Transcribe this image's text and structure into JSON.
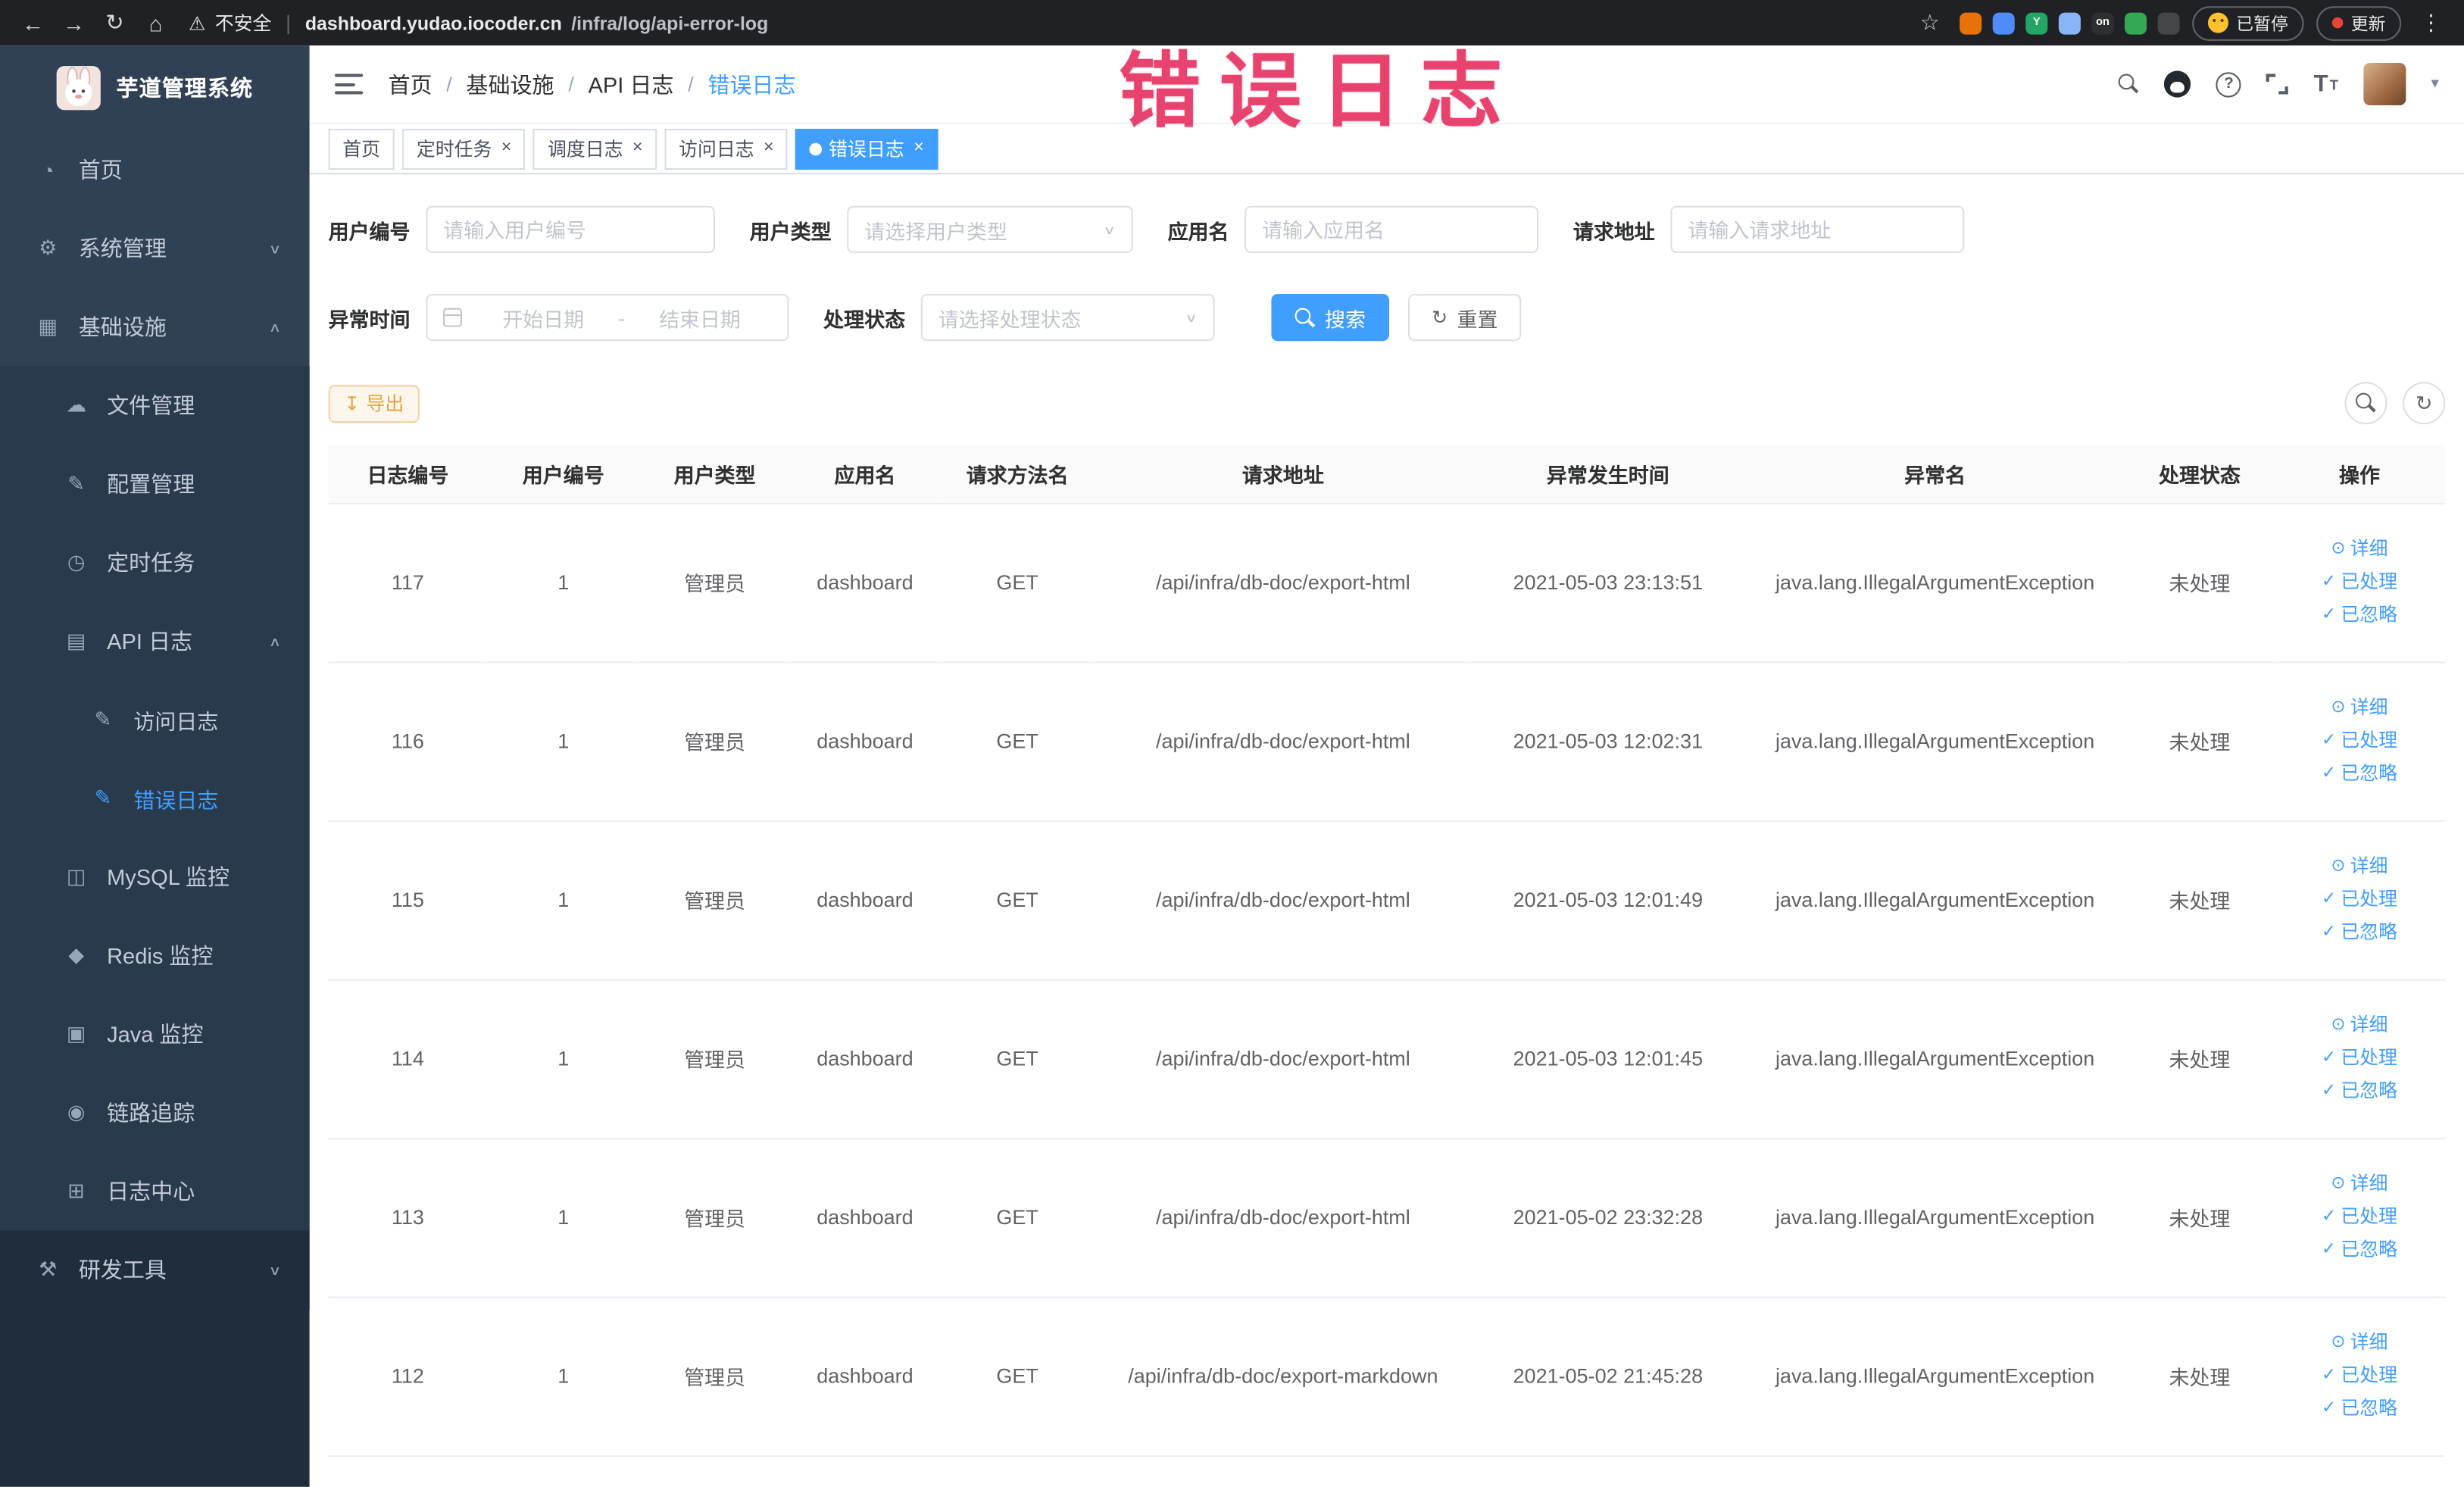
{
  "colors": {
    "accent": "#409eff",
    "sidebar_bg": "#304156",
    "sidebar_dark": "#1f2d3d",
    "warning_orange": "#e6a23c",
    "annotation_pink": "#e8436e"
  },
  "browser": {
    "security": "不安全",
    "url_host": "dashboard.yudao.iocoder.cn",
    "url_path": "/infra/log/api-error-log",
    "paused_pill": "已暂停",
    "update_pill": "更新",
    "extensions": [
      {
        "color": "#e8710a"
      },
      {
        "color": "#4e8cf9"
      },
      {
        "color": "#23a566",
        "text": "Y"
      },
      {
        "color": "#8ab4f8"
      },
      {
        "color": "#2d2f31",
        "text": "on"
      },
      {
        "color": "#34a853"
      },
      {
        "color": "#44474a"
      }
    ]
  },
  "annotation": {
    "text": "错误日志"
  },
  "sidebar": {
    "title": "芋道管理系统",
    "menu": [
      {
        "label": "首页",
        "icon": "dashboard-icon",
        "level": 1
      },
      {
        "label": "系统管理",
        "icon": "gear-icon",
        "level": 1,
        "arrow": "down"
      },
      {
        "label": "基础设施",
        "icon": "infrastructure-icon",
        "level": 1,
        "arrow": "up"
      },
      {
        "label": "文件管理",
        "icon": "file-icon",
        "level": 2
      },
      {
        "label": "配置管理",
        "icon": "config-icon",
        "level": 2
      },
      {
        "label": "定时任务",
        "icon": "job-icon",
        "level": 2
      },
      {
        "label": "API 日志",
        "icon": "api-log-icon",
        "level": 2,
        "arrow": "up"
      },
      {
        "label": "访问日志",
        "icon": "access-log-icon",
        "level": 3
      },
      {
        "label": "错误日志",
        "icon": "error-log-icon",
        "level": 3,
        "active": true
      },
      {
        "label": "MySQL 监控",
        "icon": "mysql-icon",
        "level": 2
      },
      {
        "label": "Redis 监控",
        "icon": "redis-icon",
        "level": 2
      },
      {
        "label": "Java 监控",
        "icon": "java-icon",
        "level": 2
      },
      {
        "label": "链路追踪",
        "icon": "trace-icon",
        "level": 2
      },
      {
        "label": "日志中心",
        "icon": "log-center-icon",
        "level": 2
      },
      {
        "label": "研发工具",
        "icon": "devtools-icon",
        "level": 1,
        "arrow": "down",
        "dark": true
      }
    ]
  },
  "header": {
    "breadcrumb": [
      "首页",
      "基础设施",
      "API 日志",
      "错误日志"
    ]
  },
  "tabs": [
    {
      "label": "首页"
    },
    {
      "label": "定时任务",
      "closable": true
    },
    {
      "label": "调度日志",
      "closable": true
    },
    {
      "label": "访问日志",
      "closable": true
    },
    {
      "label": "错误日志",
      "closable": true,
      "active": true
    }
  ],
  "filters": {
    "user_id": {
      "label": "用户编号",
      "placeholder": "请输入用户编号"
    },
    "user_type": {
      "label": "用户类型",
      "placeholder": "请选择用户类型"
    },
    "app_name": {
      "label": "应用名",
      "placeholder": "请输入应用名"
    },
    "request_url": {
      "label": "请求地址",
      "placeholder": "请输入请求地址"
    },
    "exception_time": {
      "label": "异常时间",
      "start": "开始日期",
      "separator": "-",
      "end": "结束日期"
    },
    "process_status": {
      "label": "处理状态",
      "placeholder": "请选择处理状态"
    },
    "search": "搜索",
    "reset": "重置"
  },
  "toolbar": {
    "export": "导出"
  },
  "table": {
    "headers": [
      "日志编号",
      "用户编号",
      "用户类型",
      "应用名",
      "请求方法名",
      "请求地址",
      "异常发生时间",
      "异常名",
      "处理状态",
      "操作"
    ],
    "actions": [
      {
        "label": "详细",
        "icon": "eye-icon"
      },
      {
        "label": "已处理",
        "icon": "check-icon"
      },
      {
        "label": "已忽略",
        "icon": "check-icon"
      }
    ],
    "rows": [
      {
        "id": "117",
        "user_id": "1",
        "user_type": "管理员",
        "app": "dashboard",
        "method": "GET",
        "url": "/api/infra/db-doc/export-html",
        "time": "2021-05-03 23:13:51",
        "exception": "java.lang.IllegalArgumentException",
        "status": "未处理"
      },
      {
        "id": "116",
        "user_id": "1",
        "user_type": "管理员",
        "app": "dashboard",
        "method": "GET",
        "url": "/api/infra/db-doc/export-html",
        "time": "2021-05-03 12:02:31",
        "exception": "java.lang.IllegalArgumentException",
        "status": "未处理"
      },
      {
        "id": "115",
        "user_id": "1",
        "user_type": "管理员",
        "app": "dashboard",
        "method": "GET",
        "url": "/api/infra/db-doc/export-html",
        "time": "2021-05-03 12:01:49",
        "exception": "java.lang.IllegalArgumentException",
        "status": "未处理"
      },
      {
        "id": "114",
        "user_id": "1",
        "user_type": "管理员",
        "app": "dashboard",
        "method": "GET",
        "url": "/api/infra/db-doc/export-html",
        "time": "2021-05-03 12:01:45",
        "exception": "java.lang.IllegalArgumentException",
        "status": "未处理"
      },
      {
        "id": "113",
        "user_id": "1",
        "user_type": "管理员",
        "app": "dashboard",
        "method": "GET",
        "url": "/api/infra/db-doc/export-html",
        "time": "2021-05-02 23:32:28",
        "exception": "java.lang.IllegalArgumentException",
        "status": "未处理"
      },
      {
        "id": "112",
        "user_id": "1",
        "user_type": "管理员",
        "app": "dashboard",
        "method": "GET",
        "url": "/api/infra/db-doc/export-markdown",
        "time": "2021-05-02 21:45:28",
        "exception": "java.lang.IllegalArgumentException",
        "status": "未处理"
      }
    ]
  }
}
